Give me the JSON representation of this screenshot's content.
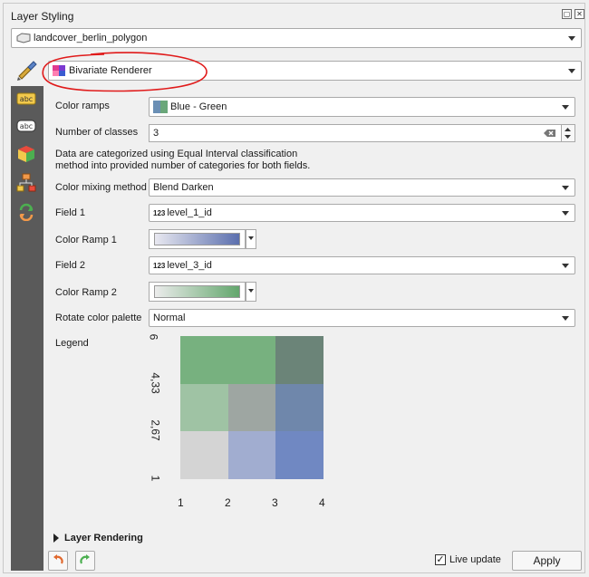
{
  "panel": {
    "title": "Layer Styling",
    "layer_name": "landcover_berlin_polygon",
    "renderer": "Bivariate Renderer"
  },
  "form": {
    "color_ramps_label": "Color ramps",
    "color_ramps_value": "Blue - Green",
    "num_classes_label": "Number of classes",
    "num_classes_value": "3",
    "description": "Data are categorized using Equal Interval classification method into provided number of categories for both fields.",
    "mixing_label": "Color mixing method",
    "mixing_value": "Blend Darken",
    "field1_label": "Field 1",
    "field1_value": "level_1_id",
    "ramp1_label": "Color Ramp 1",
    "field2_label": "Field 2",
    "field2_value": "level_3_id",
    "ramp2_label": "Color Ramp 2",
    "rotate_label": "Rotate color palette",
    "rotate_value": "Normal",
    "field_type_badge": "123"
  },
  "legend": {
    "label": "Legend",
    "y_ticks": [
      "6",
      "4,33",
      "2,67",
      "1"
    ],
    "x_ticks": [
      "1",
      "2",
      "3",
      "4"
    ],
    "cells": [
      [
        "#77b17f",
        "#77b17f",
        "#6b8478"
      ],
      [
        "#9fc3a4",
        "#9ea6a2",
        "#6f87ab"
      ],
      [
        "#d4d4d4",
        "#a1add0",
        "#7088c2"
      ]
    ]
  },
  "footer": {
    "section": "Layer Rendering",
    "live_update": "Live update",
    "apply": "Apply"
  },
  "colors": {
    "annotation": "#e01a1a",
    "ramp1_start": "#e8e8f0",
    "ramp1_end": "#5b6fae",
    "ramp2_start": "#ececec",
    "ramp2_end": "#62a66c"
  }
}
